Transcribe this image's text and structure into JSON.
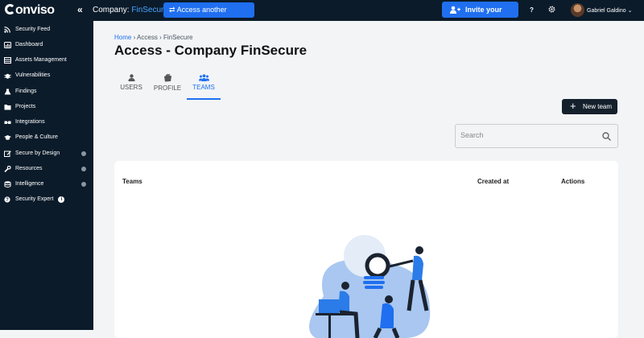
{
  "topbar": {
    "logo_text": "onviso",
    "company_label": "Company:",
    "company_name": "FinSecure",
    "access_button": "Access another company",
    "invite_button": "Invite your team",
    "help_label": "?",
    "user_name": "Gabriel Galdino"
  },
  "sidebar": {
    "items": [
      {
        "label": "Security Feed",
        "icon": "rss-icon"
      },
      {
        "label": "Dashboard",
        "icon": "dashboard-icon"
      },
      {
        "label": "Assets Management",
        "icon": "assets-icon"
      },
      {
        "label": "Vulnerabilities",
        "icon": "bug-icon"
      },
      {
        "label": "Findings",
        "icon": "flask-icon"
      },
      {
        "label": "Projects",
        "icon": "folder-icon"
      },
      {
        "label": "Integrations",
        "icon": "integration-icon"
      },
      {
        "label": "People & Culture",
        "icon": "graduation-cap-icon"
      },
      {
        "label": "Secure by Design",
        "icon": "pencil-icon"
      },
      {
        "label": "Resources",
        "icon": "wrench-icon"
      },
      {
        "label": "Intelligence",
        "icon": "database-icon"
      },
      {
        "label": "Security Expert",
        "icon": "question-icon"
      }
    ]
  },
  "breadcrumb": {
    "home": "Home",
    "sep": "›",
    "access": "Access",
    "company": "FinSecure"
  },
  "page": {
    "title": "Access - Company FinSecure"
  },
  "tabs": [
    {
      "label": "USERS",
      "icon": "user-icon"
    },
    {
      "label": "PROFILE",
      "icon": "profile-stack-icon"
    },
    {
      "label": "TEAMS",
      "icon": "team-icon",
      "active": true
    }
  ],
  "actions": {
    "new_team": "New team"
  },
  "search": {
    "placeholder": "Search",
    "value": ""
  },
  "table": {
    "headers": [
      "Teams",
      "Created at",
      "Actions"
    ]
  },
  "colors": {
    "sidebar": "#0b1b2a",
    "accent": "#1f6ff0",
    "dark_button": "#14202c",
    "background": "#f2f4f6"
  }
}
